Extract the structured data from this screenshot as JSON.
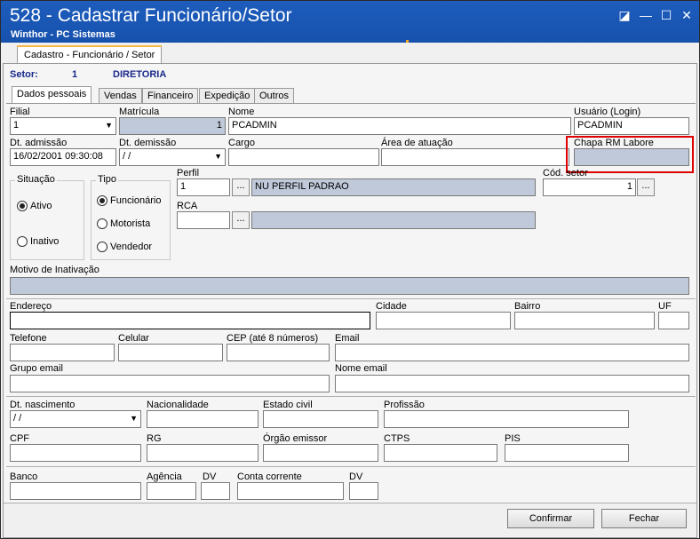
{
  "window": {
    "title": "528 - Cadastrar Funcionário/Setor",
    "subtitle": "Winthor - PC Sistemas",
    "controls": {
      "restore": "◪",
      "minimize": "—",
      "maximize": "☐",
      "close": "✕"
    }
  },
  "main_tab": "Cadastro - Funcionário / Setor",
  "setor": {
    "label": "Setor:",
    "code": "1",
    "name": "DIRETORIA"
  },
  "tabs": [
    "Dados pessoais",
    "Vendas",
    "Financeiro",
    "Expedição",
    "Outros"
  ],
  "fields": {
    "filial": {
      "label": "Filial",
      "value": "1"
    },
    "matricula": {
      "label": "Matrícula",
      "value": "1"
    },
    "nome": {
      "label": "Nome",
      "value": "PCADMIN"
    },
    "usuario": {
      "label": "Usuário (Login)",
      "value": "PCADMIN"
    },
    "dt_admissao": {
      "label": "Dt. admissão",
      "value": "16/02/2001 09:30:08"
    },
    "dt_demissao": {
      "label": "Dt. demissão",
      "value": " / /"
    },
    "cargo": {
      "label": "Cargo",
      "value": ""
    },
    "area_atuacao": {
      "label": "Área de atuação",
      "value": ""
    },
    "chapa": {
      "label": "Chapa RM Labore",
      "value": ""
    },
    "perfil": {
      "label": "Perfil",
      "code": "1",
      "desc": "NU PERFIL PADRAO"
    },
    "cod_setor": {
      "label": "Cód. setor",
      "value": "1"
    },
    "rca": {
      "label": "RCA",
      "code": "",
      "desc": ""
    },
    "motivo": {
      "label": "Motivo de Inativação",
      "value": ""
    },
    "endereco": {
      "label": "Endereço",
      "value": ""
    },
    "cidade": {
      "label": "Cidade",
      "value": ""
    },
    "bairro": {
      "label": "Bairro",
      "value": ""
    },
    "uf": {
      "label": "UF",
      "value": ""
    },
    "telefone": {
      "label": "Telefone",
      "value": ""
    },
    "celular": {
      "label": "Celular",
      "value": ""
    },
    "cep": {
      "label": "CEP (até 8 números)",
      "value": ""
    },
    "email": {
      "label": "Email",
      "value": ""
    },
    "grupo_email": {
      "label": "Grupo email",
      "value": ""
    },
    "nome_email": {
      "label": "Nome email",
      "value": ""
    },
    "dt_nascimento": {
      "label": "Dt. nascimento",
      "value": " / /"
    },
    "nacionalidade": {
      "label": "Nacionalidade",
      "value": ""
    },
    "estado_civil": {
      "label": "Estado civil",
      "value": ""
    },
    "profissao": {
      "label": "Profissão",
      "value": ""
    },
    "cpf": {
      "label": "CPF",
      "value": ""
    },
    "rg": {
      "label": "RG",
      "value": ""
    },
    "orgao_emissor": {
      "label": "Órgão emissor",
      "value": ""
    },
    "ctps": {
      "label": "CTPS",
      "value": ""
    },
    "pis": {
      "label": "PIS",
      "value": ""
    },
    "banco": {
      "label": "Banco",
      "value": ""
    },
    "agencia": {
      "label": "Agência",
      "value": ""
    },
    "dv1": {
      "label": "DV",
      "value": ""
    },
    "conta": {
      "label": "Conta corrente",
      "value": ""
    },
    "dv2": {
      "label": "DV",
      "value": ""
    }
  },
  "situacao": {
    "title": "Situação",
    "options": [
      "Ativo",
      "Inativo"
    ],
    "selected": "Ativo"
  },
  "tipo": {
    "title": "Tipo",
    "options": [
      "Funcionário",
      "Motorista",
      "Vendedor"
    ],
    "selected": "Funcionário"
  },
  "buttons": {
    "dots": "...",
    "confirmar": "Confirmar",
    "fechar": "Fechar"
  },
  "icons": {
    "combo": "▼"
  },
  "colors": {
    "titlebar": "#1651ad",
    "readonly": "#bfc9d9",
    "highlight": "#e00000"
  }
}
